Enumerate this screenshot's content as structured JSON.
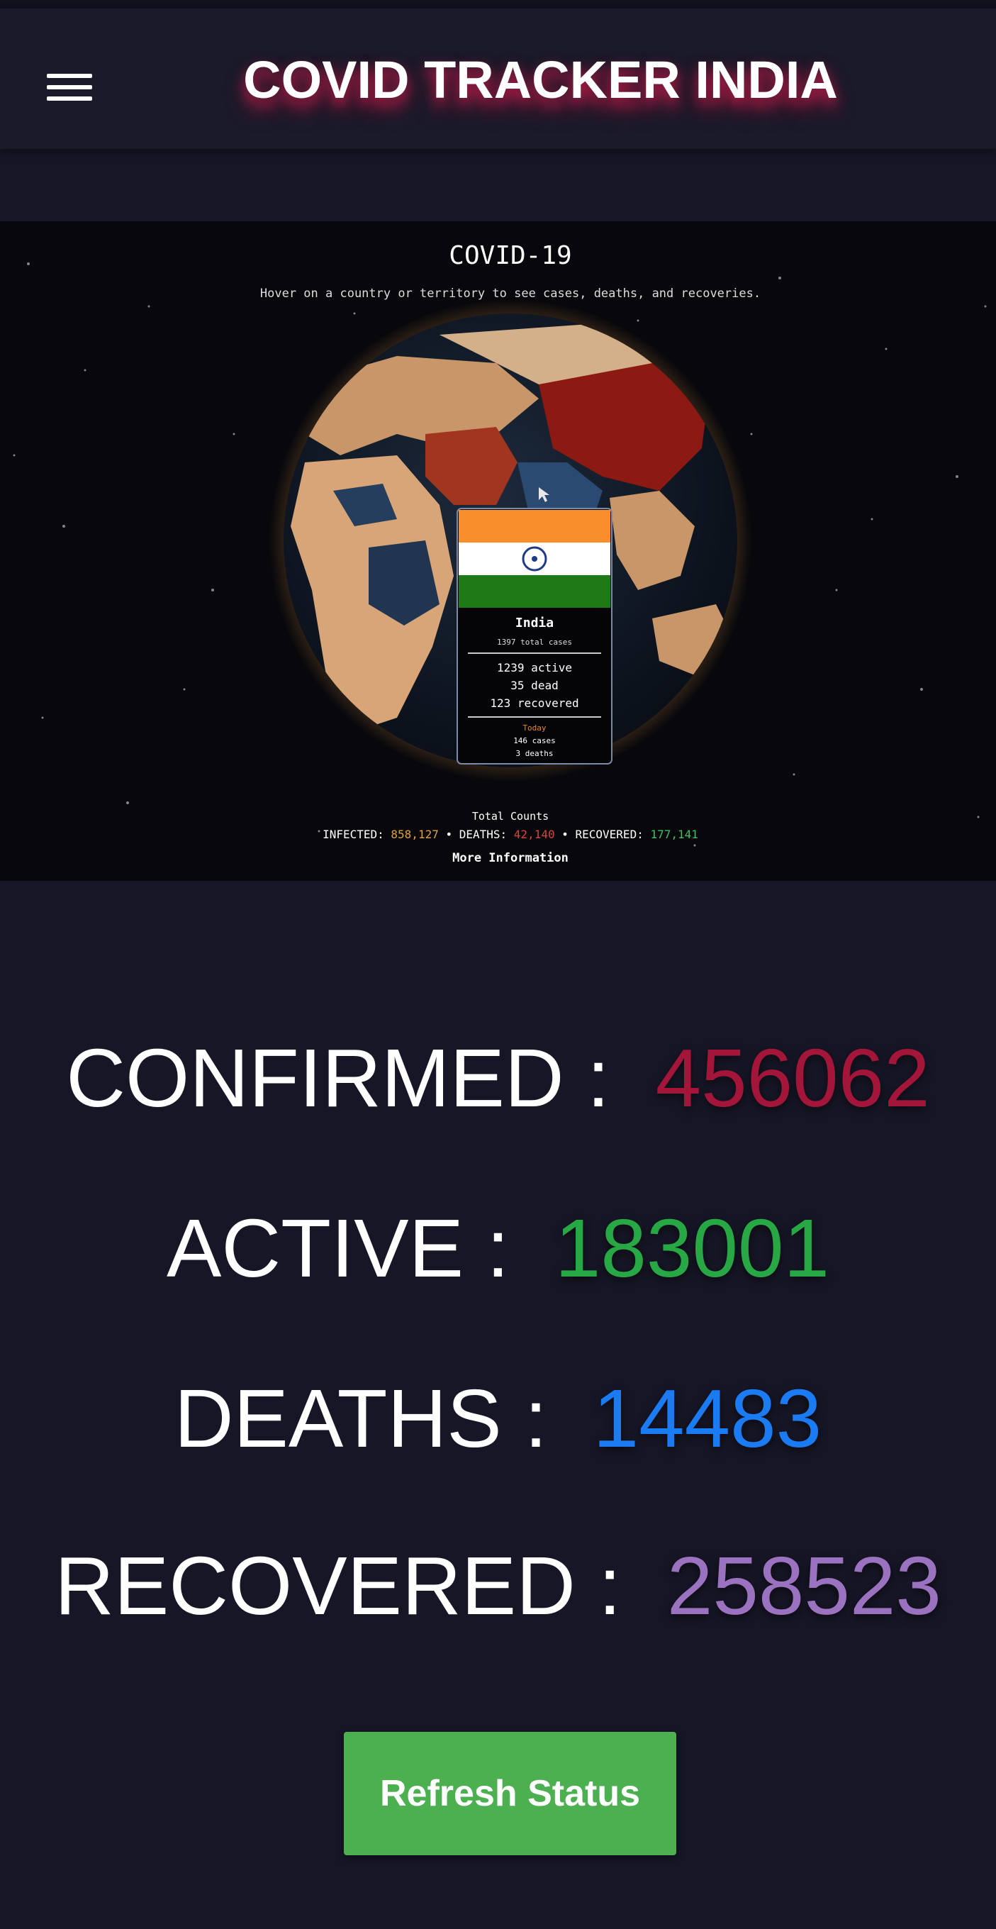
{
  "appbar": {
    "title": "COVID TRACKER INDIA",
    "menu_icon": "hamburger-menu-icon"
  },
  "globe_image": {
    "heading": "COVID-19",
    "subheading": "Hover on a country or territory to see cases, deaths, and recoveries.",
    "tooltip": {
      "country": "India",
      "total_cases": "1397 total cases",
      "active": "1239 active",
      "dead": "35 dead",
      "recovered": "123 recovered",
      "today_label": "Today",
      "today_cases": "146 cases",
      "today_deaths": "3 deaths"
    },
    "totals_heading": "Total Counts",
    "infected_label": "INFECTED:",
    "infected_value": "858,127",
    "deaths_label": "DEATHS:",
    "deaths_value": "42,140",
    "recovered_label": "RECOVERED:",
    "recovered_value": "177,141",
    "separator": "•",
    "more_info": "More Information"
  },
  "stats": {
    "separator": ":",
    "confirmed": {
      "label": "CONFIRMED",
      "value": "456062",
      "color": "#a3163a"
    },
    "active": {
      "label": "ACTIVE",
      "value": "183001",
      "color": "#28a745"
    },
    "deaths": {
      "label": "DEATHS",
      "value": "14483",
      "color": "#1a7bf2"
    },
    "recovered": {
      "label": "RECOVERED",
      "value": "258523",
      "color": "#9b72c0"
    }
  },
  "refresh_button": {
    "label": "Refresh Status",
    "color": "#4caf50"
  }
}
